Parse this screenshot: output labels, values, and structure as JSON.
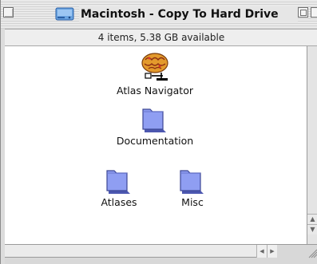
{
  "window": {
    "title": "Macintosh - Copy To Hard Drive",
    "status": "4 items, 5.38 GB available"
  },
  "items": [
    {
      "label": "Atlas Navigator",
      "icon": "brain-app-icon"
    },
    {
      "label": "Documentation",
      "icon": "folder-icon"
    },
    {
      "label": "Atlases",
      "icon": "folder-icon"
    },
    {
      "label": "Misc",
      "icon": "folder-icon"
    }
  ],
  "colors": {
    "folder": "#8f9ef2",
    "folder_shadow": "#4c57b0",
    "content_bg": "#ffffff",
    "chrome_bg": "#dcdcdc"
  }
}
